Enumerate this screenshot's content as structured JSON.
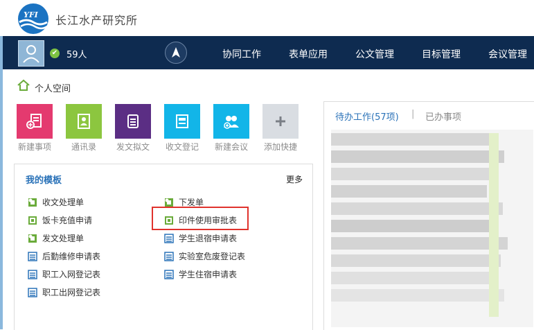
{
  "header": {
    "org_name": "长江水产研究所",
    "logo_text": "YFI"
  },
  "navbar": {
    "online_count": "59人",
    "items": [
      "协同工作",
      "表单应用",
      "公文管理",
      "目标管理",
      "会议管理"
    ]
  },
  "breadcrumb": {
    "label": "个人空间"
  },
  "quick_actions": [
    {
      "label": "新建事项",
      "color": "#e43a6f"
    },
    {
      "label": "通讯录",
      "color": "#8cc63f"
    },
    {
      "label": "发文拟文",
      "color": "#5b2e84"
    },
    {
      "label": "收文登记",
      "color": "#12b5e8"
    },
    {
      "label": "新建会议",
      "color": "#12b5e8"
    },
    {
      "label": "添加快捷",
      "color": "#d9dde2"
    }
  ],
  "templates": {
    "title": "我的模板",
    "more_label": "更多",
    "left_column": [
      "收文处理单",
      "饭卡充值申请",
      "发文处理单",
      "后勤维修申请表",
      "职工入网登记表",
      "职工出网登记表"
    ],
    "right_column": [
      "下发单",
      "印件使用审批表",
      "学生退宿申请表",
      "实验室危废登记表",
      "学生住宿申请表"
    ]
  },
  "tasks": {
    "pending_label": "待办工作(57项)",
    "separator": "|",
    "done_label": "已办事项"
  },
  "colors": {
    "navbar": "#0e2b50",
    "accent": "#2a72b8",
    "highlight": "#e0322c",
    "form_icon": "#6aab3a",
    "table_icon": "#2a72b8"
  }
}
